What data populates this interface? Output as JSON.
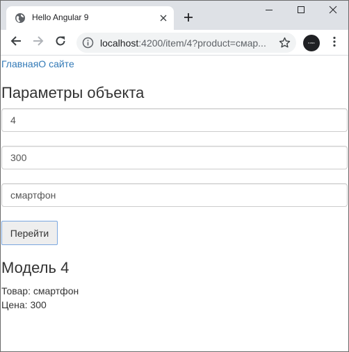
{
  "browser": {
    "tab_title": "Hello Angular 9",
    "url_host": "localhost",
    "url_path": ":4200/item/4?product=смар...",
    "avatar_text": "P-PRO"
  },
  "icons": {
    "favicon": "globe-icon",
    "tab_close": "close-icon",
    "new_tab": "plus-icon",
    "minimize": "minimize-icon",
    "maximize": "maximize-icon",
    "window_close": "close-icon",
    "back": "arrow-left-icon",
    "forward": "arrow-right-icon",
    "reload": "reload-icon",
    "site_info": "info-icon",
    "bookmark": "star-icon",
    "menu": "kebab-menu-icon"
  },
  "nav": {
    "home": "Главная",
    "about": "О сайте"
  },
  "page": {
    "heading": "Параметры объекта"
  },
  "form": {
    "id_value": "4",
    "price_value": "300",
    "product_value": "смартфон",
    "submit_label": "Перейти"
  },
  "result": {
    "model_title": "Модель 4",
    "product_line": "Товар: смартфон",
    "price_line": "Цена: 300"
  },
  "colors": {
    "tabstrip_bg": "#dee1e6",
    "link": "#337ab7",
    "text": "#333333",
    "button_border": "#7aa7e0"
  }
}
